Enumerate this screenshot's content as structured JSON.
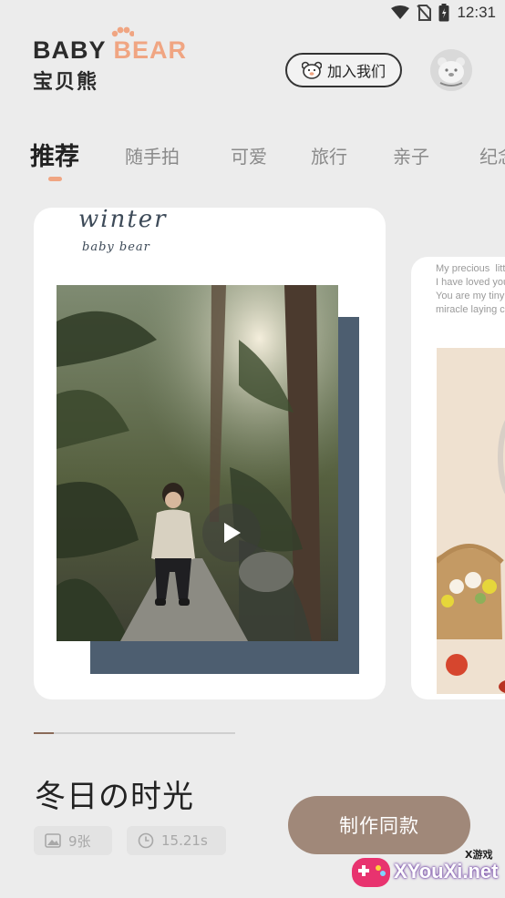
{
  "status_bar": {
    "time": "12:31",
    "icons": [
      "wifi-icon",
      "no-sim-icon",
      "battery-icon"
    ]
  },
  "header": {
    "logo_line1_a": "BABY",
    "logo_line1_b": "BEAR",
    "logo_line2": "宝贝熊",
    "join_label": "加入我们"
  },
  "tabs": [
    {
      "label": "推荐",
      "active": true
    },
    {
      "label": "随手拍"
    },
    {
      "label": "可爱"
    },
    {
      "label": "旅行"
    },
    {
      "label": "亲子"
    },
    {
      "label": "纪念"
    }
  ],
  "card": {
    "title": "winter",
    "subtitle": "baby bear",
    "play_icon": "play-icon"
  },
  "card2": {
    "text": "My precious  litt\nI have loved you\nYou are my tiny\nmiracle laying c"
  },
  "template": {
    "title": "冬日の时光",
    "photo_count": "9张",
    "duration": "15.21s",
    "make_label": "制作同款"
  },
  "watermark": {
    "text": "XYouXi.net",
    "small": "X游戏"
  },
  "colors": {
    "accent": "#f0a582",
    "button": "#a08879",
    "card_accent_block": "#4d5e70",
    "background": "#ececec"
  }
}
